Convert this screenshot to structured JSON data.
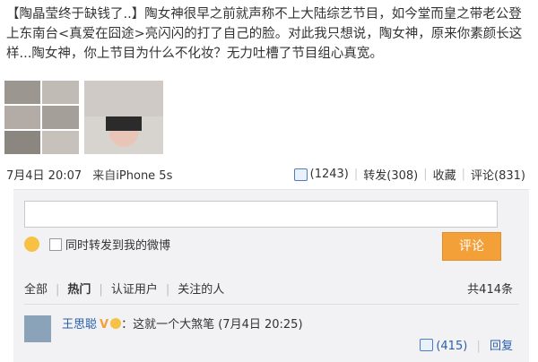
{
  "post": {
    "text_line1": "【陶晶莹终于缺钱了..】陶女神很早之前就声称不上大陆综艺节目，如今堂而皇之带老公登",
    "text_line2": "上东南台<真爱在囧途>亮闪闪的打了自己的脸。对此我只想说，陶女神，原来你素颜长这",
    "text_line3": "样...陶女神，你上节目为什么不化妆？无力吐槽了节目组心真宽。"
  },
  "meta": {
    "date": "7月4日 20:07",
    "source_prefix": "来自",
    "source": "iPhone 5s"
  },
  "actions": {
    "like": "(1243)",
    "repost": "转发(308)",
    "fav": "收藏",
    "comment": "评论(831)"
  },
  "comment_form": {
    "repost_label": "同时转发到我的微博",
    "submit": "评论"
  },
  "tabs": {
    "all": "全部",
    "hot": "热门",
    "verified": "认证用户",
    "following": "关注的人",
    "count": "共414条"
  },
  "comment": {
    "user": "王思聪",
    "badge": "V",
    "text": "：这就一个大煞笔",
    "time": "(7月4日 20:25)",
    "like": "(415)",
    "reply": "回复"
  },
  "colors": {
    "link": "#2a5faa",
    "submit": "#f3a039"
  }
}
